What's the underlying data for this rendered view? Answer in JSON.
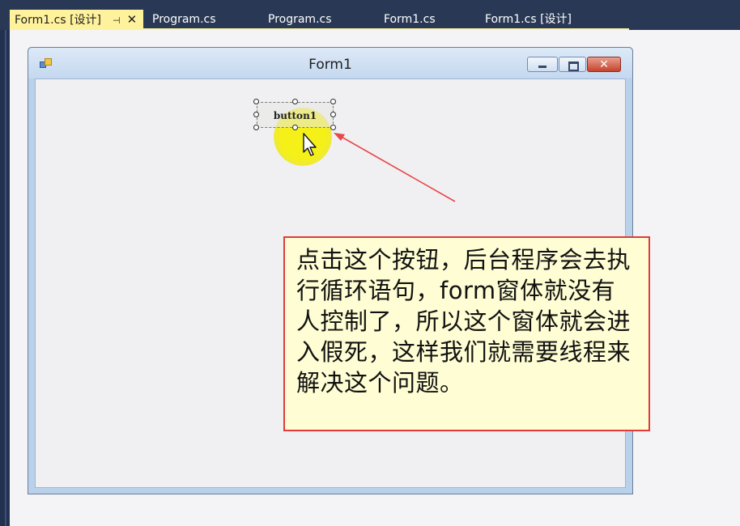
{
  "tabs": [
    {
      "label": "Form1.cs [设计]",
      "active": true,
      "pin_glyph": "⊣",
      "close_glyph": "✕"
    },
    {
      "label": "Program.cs",
      "active": false
    },
    {
      "label": "Program.cs",
      "active": false
    },
    {
      "label": "Form1.cs",
      "active": false
    },
    {
      "label": "Form1.cs [设计]",
      "active": false
    }
  ],
  "form": {
    "title": "Form1",
    "icon": "form-app-icon",
    "minimize_icon": "minimize-icon",
    "maximize_icon": "maximize-icon",
    "close_icon": "close-icon",
    "close_glyph": "✕"
  },
  "button1": {
    "label": "button1",
    "selected": true
  },
  "cursor_icon": "mouse-pointer-icon",
  "annotation": {
    "text": "点击这个按钮，后台程序会去执行循环语句，form窗体就没有人控制了，所以这个窗体就会进入假死，这样我们就需要线程来解决这个问题。",
    "border_color": "#e23a3a",
    "background": "#fefdd3"
  },
  "colors": {
    "tab_bar": "#293955",
    "active_tab": "#fff29d",
    "highlight": "#f4f018"
  }
}
